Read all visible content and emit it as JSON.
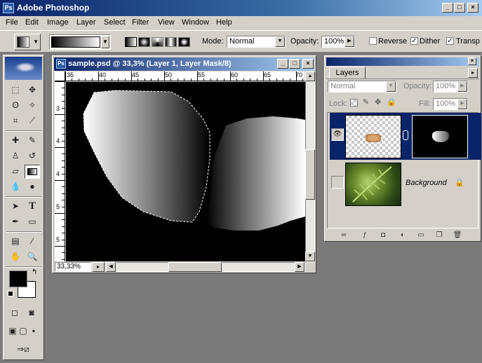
{
  "window": {
    "title": "Adobe Photoshop",
    "icon": "photoshop-icon"
  },
  "menu": [
    "File",
    "Edit",
    "Image",
    "Layer",
    "Select",
    "Filter",
    "View",
    "Window",
    "Help"
  ],
  "options": {
    "mode_label": "Mode:",
    "mode_value": "Normal",
    "opacity_label": "Opacity:",
    "opacity_value": "100%",
    "reverse_label": "Reverse",
    "dither_label": "Dither",
    "transparency_label": "Transp",
    "reverse_checked": false,
    "dither_checked": true,
    "transparency_checked": true
  },
  "document": {
    "title": "sample.psd @ 33,3% (Layer 1, Layer Mask/8)",
    "zoom": "33,33%",
    "ruler_h": [
      "35",
      "40",
      "45",
      "50",
      "55",
      "60",
      "65",
      "70"
    ],
    "ruler_v": [
      "3",
      "4",
      "4",
      "5",
      "5"
    ]
  },
  "layers": {
    "tab": "Layers",
    "blend_mode": "Normal",
    "opacity_label": "Opacity:",
    "opacity_value": "100%",
    "lock_label": "Lock:",
    "fill_label": "Fill:",
    "fill_value": "100%",
    "items": [
      {
        "name": "",
        "visible": true,
        "has_mask": true
      },
      {
        "name": "Background",
        "visible": false,
        "locked": true
      }
    ]
  },
  "colors": {
    "foreground": "#000000",
    "background": "#ffffff",
    "accent": "#0a246a"
  }
}
